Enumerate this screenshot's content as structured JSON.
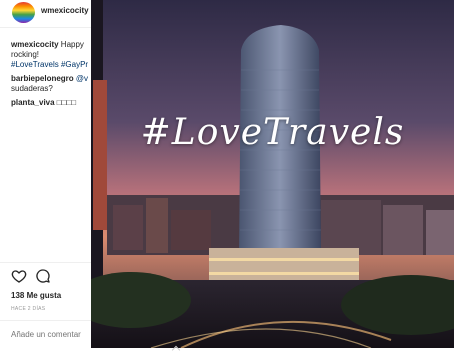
{
  "post": {
    "username": "wmexicocity",
    "caption_author": "wmexicocity",
    "caption_text": " Happy rocking!",
    "caption_tags": "#LoveTravels #GayPr",
    "comments": [
      {
        "author": "barbiepelonegro",
        "mention": " @v",
        "text": " sudaderas?"
      },
      {
        "author": "planta_viva",
        "text": " □□□□"
      }
    ],
    "likes": "138 Me gusta",
    "timestamp": "HACE 2 DÍAS",
    "comment_placeholder": "Añade un comentar",
    "photo_overlay_text": "#LoveTravels"
  },
  "icons": {
    "like": "heart-icon",
    "comment": "comment-bubble-icon"
  },
  "colors": {
    "link": "#003569",
    "muted": "#999999",
    "text": "#262626"
  }
}
